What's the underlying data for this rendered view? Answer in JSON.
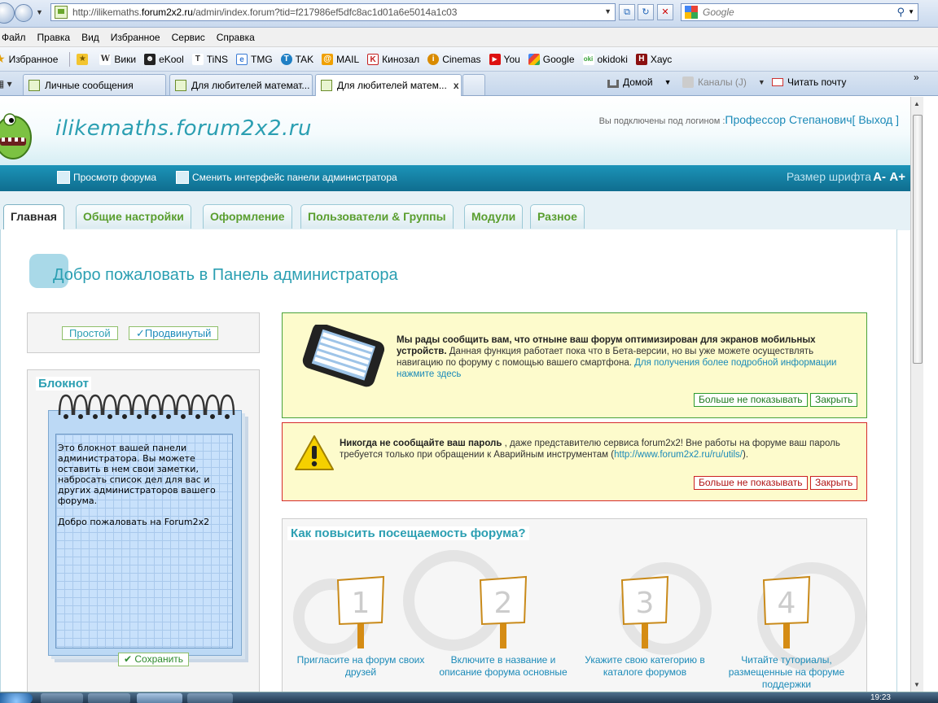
{
  "browser": {
    "url": "http://ilikemaths.forum2x2.ru/admin/index.forum?tid=f217986ef5dfc8ac1d01a6e5014a1c03",
    "url_prefix": "http://ilikemaths.",
    "url_host": "forum2x2.ru",
    "url_path": "/admin/index.forum?tid=f217986ef5dfc8ac1d01a6e5014a1c03",
    "search_placeholder": "Google",
    "menu": [
      "Файл",
      "Правка",
      "Вид",
      "Избранное",
      "Сервис",
      "Справка"
    ],
    "favorites_label": "Избранное",
    "favorites": [
      {
        "label": "Вики",
        "icon": "wiki-icon",
        "color": "#333333"
      },
      {
        "label": "eKool",
        "icon": "ekool-icon",
        "color": "#222222"
      },
      {
        "label": "TiNS",
        "icon": "tins-icon",
        "color": "#555555"
      },
      {
        "label": "TMG",
        "icon": "tmg-icon",
        "color": "#3a7bd5"
      },
      {
        "label": "TAK",
        "icon": "tak-icon",
        "color": "#1f7fc4"
      },
      {
        "label": "MAIL",
        "icon": "mail-icon",
        "color": "#f0a000"
      },
      {
        "label": "Кинозал",
        "icon": "kinozal-icon",
        "color": "#c42020"
      },
      {
        "label": "Cinemas",
        "icon": "cinemas-icon",
        "color": "#d98b00"
      },
      {
        "label": "You",
        "icon": "youtube-icon",
        "color": "#dd1111"
      },
      {
        "label": "Google",
        "icon": "google-icon",
        "color": "#3a7bd5"
      },
      {
        "label": "okidoki",
        "icon": "okidoki-icon",
        "color": "#3aa33a"
      },
      {
        "label": "Хаус",
        "icon": "house-icon",
        "color": "#8b1010"
      }
    ],
    "tabs": [
      {
        "label": "Личные сообщения"
      },
      {
        "label": "Для любителей математ..."
      },
      {
        "label": "Для любителей матем..."
      }
    ],
    "tools": {
      "home": "Домой",
      "feeds": "Каналы (J)",
      "mail": "Читать почту"
    }
  },
  "site": {
    "title": "ilikemaths.forum2x2.ru",
    "login_prefix": "Вы подключены под логином :",
    "username": "Профессор Степанович",
    "logout": "[ Выход ]",
    "view_forum": "Просмотр форума",
    "switch_ui": "Сменить интерфейс панели администратора",
    "font_size": "Размер шрифта",
    "font_minus": "A-",
    "font_plus": "A+"
  },
  "admin_tabs": [
    "Главная",
    "Общие настройки",
    "Оформление",
    "Пользователи & Группы",
    "Модули",
    "Разное"
  ],
  "welcome": "Добро пожаловать в Панель администратора",
  "mode": {
    "simple": "Простой",
    "advanced": "✓Продвинутый"
  },
  "notebook": {
    "title": "Блокнот",
    "text": "Это блокнот вашей панели\nадминистратора. Вы можете\nоставить в нем свои заметки,\nнабросать список дел для вас и\nдругих администраторов вашего\nфорума.\n\nДобро пожаловать на Forum2x2",
    "save": "Сохранить"
  },
  "mobile_notice": {
    "bold": "Мы рады сообщить вам, что отныне ваш форум оптимизирован для экранов мобильных устройств.",
    "text": " Данная функция работает пока что в Бета-версии, но вы уже можете осуществлять навигацию по форуму с помощью вашего смартфона. ",
    "link": "Для получения более подробной информации нажмите здесь",
    "dont_show": "Больше не показывать",
    "close": "Закрыть"
  },
  "password_notice": {
    "bold": "Никогда не сообщайте ваш пароль",
    "text": " , даже представителю сервиса forum2x2! Вне работы на форуме ваш пароль требуется только при обращении к Аварийным инструментам (",
    "link": "http://www.forum2x2.ru/ru/utils/",
    "tail": ").",
    "dont_show": "Больше не показывать",
    "close": "Закрыть"
  },
  "visits": {
    "title": "Как повысить посещаемость форума?",
    "steps": [
      {
        "num": "1",
        "label": "Пригласите на форум своих друзей"
      },
      {
        "num": "2",
        "label": "Включите в название и описание форума основные"
      },
      {
        "num": "3",
        "label": "Укажите свою категорию в каталоге форумов"
      },
      {
        "num": "4",
        "label": "Читайте туториалы, размещенные на форуме поддержки"
      }
    ]
  },
  "taskbar": {
    "clock": "19:23"
  },
  "colors": {
    "accent": "#2b9fb2",
    "header_bar": "#1c94b8",
    "green": "#49a23a",
    "red": "#d62b2b"
  }
}
